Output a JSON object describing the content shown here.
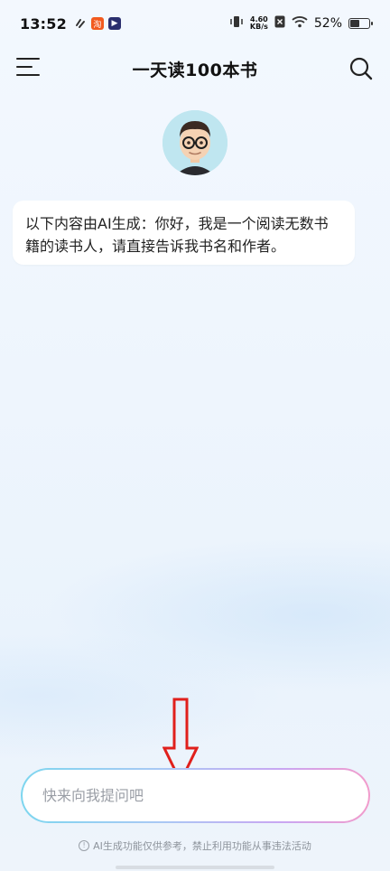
{
  "status_bar": {
    "time": "13:52",
    "net_speed_value": "4.60",
    "net_speed_unit": "KB/s",
    "battery_percent": "52%",
    "battery_level": 0.52
  },
  "header": {
    "title": "一天读100本书",
    "menu_icon": "menu-icon",
    "search_icon": "search-icon"
  },
  "chat": {
    "message": "以下内容由AI生成：你好，我是一个阅读无数书籍的读书人，请直接告诉我书名和作者。"
  },
  "input": {
    "placeholder": "快来向我提问吧"
  },
  "footer": {
    "disclaimer": "AI生成功能仅供参考，禁止利用功能从事违法活动"
  },
  "colors": {
    "input_border_start": "#7dd6ef",
    "input_border_end": "#f29ccb",
    "arrow": "#e0201c"
  }
}
